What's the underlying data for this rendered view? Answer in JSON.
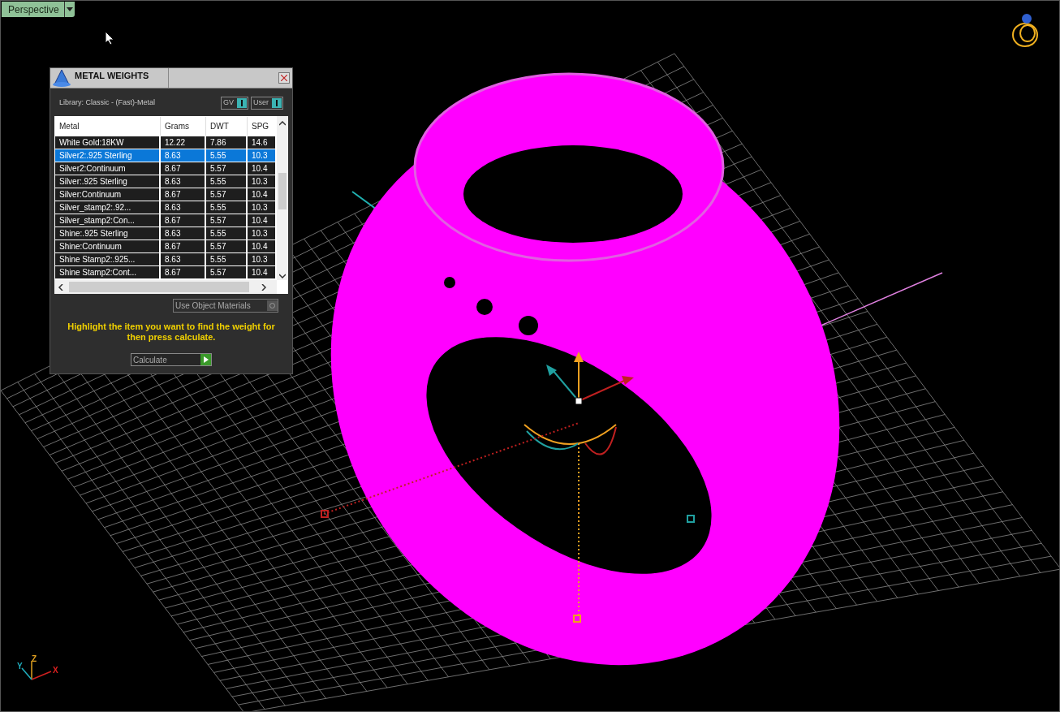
{
  "viewport": {
    "view_menu": "Perspective",
    "axes": {
      "x": "X",
      "y": "Y",
      "z": "Z"
    }
  },
  "dialog": {
    "title": "METAL WEIGHTS",
    "library": "Library: Classic - (Fast)-Metal",
    "toggles": [
      {
        "label": "GV",
        "on": true
      },
      {
        "label": "User",
        "on": true
      }
    ],
    "table": {
      "columns": [
        "Metal",
        "Grams",
        "DWT",
        "SPG"
      ],
      "rows": [
        {
          "cells": [
            "White Gold:18KW",
            "12.22",
            "7.86",
            "14.6"
          ],
          "selected": false
        },
        {
          "cells": [
            "Silver2:.925 Sterling",
            "8.63",
            "5.55",
            "10.3"
          ],
          "selected": true
        },
        {
          "cells": [
            "Silver2:Continuum",
            "8.67",
            "5.57",
            "10.4"
          ],
          "selected": false
        },
        {
          "cells": [
            "Silver:.925 Sterling",
            "8.63",
            "5.55",
            "10.3"
          ],
          "selected": false
        },
        {
          "cells": [
            "Silver:Continuum",
            "8.67",
            "5.57",
            "10.4"
          ],
          "selected": false
        },
        {
          "cells": [
            "Silver_stamp2:.92...",
            "8.63",
            "5.55",
            "10.3"
          ],
          "selected": false
        },
        {
          "cells": [
            "Silver_stamp2:Con...",
            "8.67",
            "5.57",
            "10.4"
          ],
          "selected": false
        },
        {
          "cells": [
            "Shine:.925 Sterling",
            "8.63",
            "5.55",
            "10.3"
          ],
          "selected": false
        },
        {
          "cells": [
            "Shine:Continuum",
            "8.67",
            "5.57",
            "10.4"
          ],
          "selected": false
        },
        {
          "cells": [
            "Shine Stamp2:.925...",
            "8.63",
            "5.55",
            "10.3"
          ],
          "selected": false
        },
        {
          "cells": [
            "Shine Stamp2:Cont...",
            "8.67",
            "5.57",
            "10.4"
          ],
          "selected": false
        }
      ]
    },
    "use_object_materials": {
      "label": "Use Object Materials",
      "checked": false
    },
    "hint": "Highlight the item you want to find the weight for then press calculate.",
    "calculate_button": "Calculate"
  }
}
